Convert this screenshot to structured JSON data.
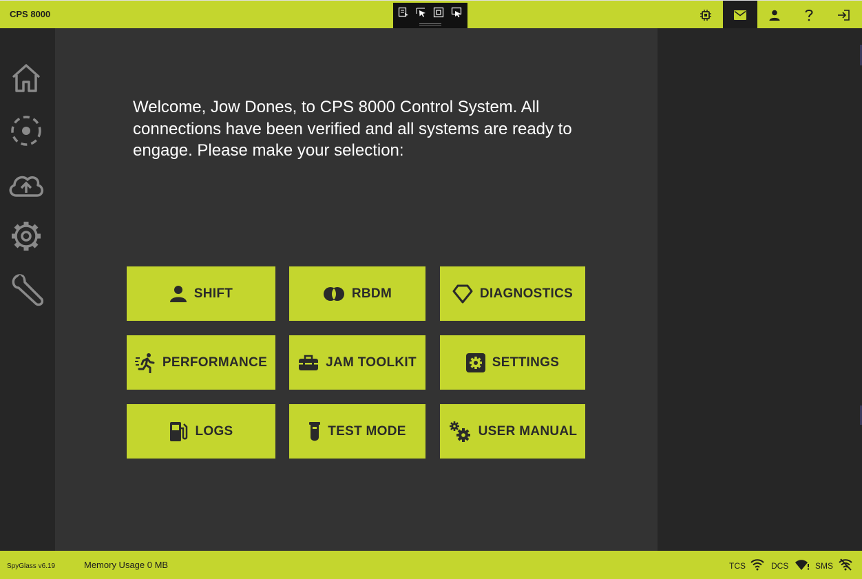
{
  "app": {
    "title": "CPS 8000"
  },
  "welcome_text": "Welcome, Jow Dones, to CPS 8000 Control System. All connections have been verified and all systems are ready to engage. Please make your selection:",
  "tiles": [
    {
      "label": "SHIFT",
      "icon": "user-icon"
    },
    {
      "label": "RBDM",
      "icon": "rings-icon"
    },
    {
      "label": "DIAGNOSTICS",
      "icon": "diamond-icon"
    },
    {
      "label": "PERFORMANCE",
      "icon": "running-icon"
    },
    {
      "label": "JAM TOOLKIT",
      "icon": "toolbox-icon"
    },
    {
      "label": "SETTINGS",
      "icon": "gear-square-icon"
    },
    {
      "label": "LOGS",
      "icon": "fuel-icon"
    },
    {
      "label": "TEST MODE",
      "icon": "test-tube-icon"
    },
    {
      "label": "USER MANUAL",
      "icon": "gears-icon"
    }
  ],
  "sidebar_icons": [
    "home-icon",
    "loading-circle-icon",
    "cloud-upload-icon",
    "settings-icon",
    "wrench-icon"
  ],
  "top_icons": [
    "chip-icon",
    "mail-icon",
    "user-icon",
    "help-icon",
    "logout-icon"
  ],
  "status": {
    "version": "SpyGlass v6.19",
    "memory": "Memory Usage 0 MB",
    "tcs": "TCS",
    "dcs": "DCS",
    "sms": "SMS"
  },
  "colors": {
    "accent": "#c4d62e",
    "dark": "#262626",
    "panel": "#333333",
    "text_dark": "#2a2a2a"
  }
}
